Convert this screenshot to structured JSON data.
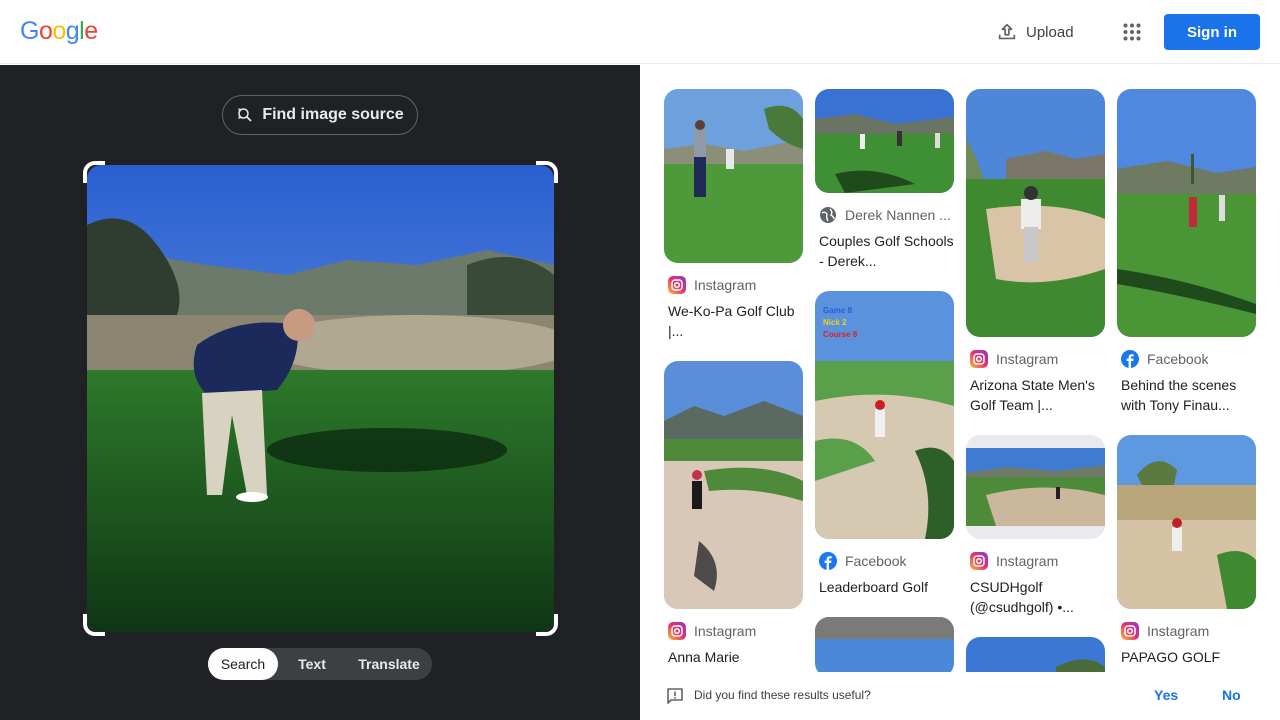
{
  "header": {
    "logo": [
      "G",
      "o",
      "o",
      "g",
      "l",
      "e"
    ],
    "logo_colors": [
      "#4285F4",
      "#EA4335",
      "#FBBC05",
      "#4285F4",
      "#34A853",
      "#EA4335"
    ],
    "upload_label": "Upload",
    "apps_icon": "apps-grid-icon",
    "signin_label": "Sign in"
  },
  "lens": {
    "find_source_label": "Find image source",
    "modes": [
      "Search",
      "Text",
      "Translate"
    ],
    "active_mode": "Search"
  },
  "results": {
    "col1": [
      {
        "source": "Instagram",
        "source_icon": "instagram-icon",
        "title": "We-Ko-Pa Golf Club |..."
      },
      {
        "source": "Instagram",
        "source_icon": "instagram-icon",
        "title": "Anna Marie"
      }
    ],
    "col2": [
      {
        "source": "Derek Nannen ...",
        "source_icon": "globe-icon",
        "title": "Couples Golf Schools - Derek..."
      },
      {
        "source": "Facebook",
        "source_icon": "facebook-icon",
        "title": "Leaderboard Golf"
      }
    ],
    "col3": [
      {
        "source": "Instagram",
        "source_icon": "instagram-icon",
        "title": "Arizona State Men's Golf Team |..."
      },
      {
        "source": "Instagram",
        "source_icon": "instagram-icon",
        "title": "CSUDHgolf (@csudhgolf) •..."
      }
    ],
    "col4": [
      {
        "source": "Facebook",
        "source_icon": "facebook-icon",
        "title": "Behind the scenes with Tony Finau..."
      },
      {
        "source": "Instagram",
        "source_icon": "instagram-icon",
        "title": "PAPAGO GOLF"
      }
    ],
    "thumb2_overlay": [
      "Game 8",
      "Nick 2",
      "Course 8"
    ]
  },
  "feedback": {
    "question": "Did you find these results useful?",
    "yes": "Yes",
    "no": "No"
  }
}
